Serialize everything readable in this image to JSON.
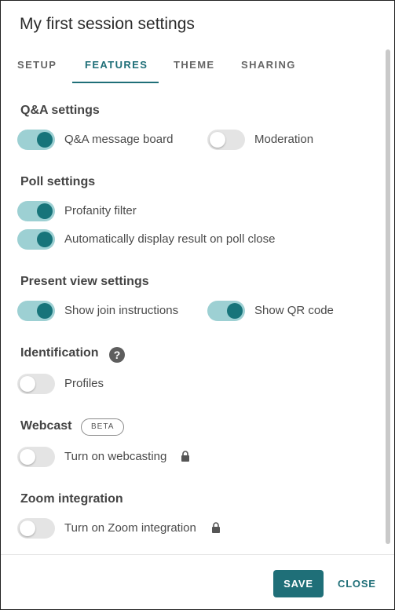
{
  "dialog": {
    "title": "My first session settings"
  },
  "tabs": [
    {
      "label": "SETUP",
      "active": false
    },
    {
      "label": "FEATURES",
      "active": true
    },
    {
      "label": "THEME",
      "active": false
    },
    {
      "label": "SHARING",
      "active": false
    }
  ],
  "sections": {
    "qa": {
      "title": "Q&A settings",
      "message_board": {
        "label": "Q&A message board",
        "on": true
      },
      "moderation": {
        "label": "Moderation",
        "on": false
      }
    },
    "poll": {
      "title": "Poll settings",
      "profanity": {
        "label": "Profanity filter",
        "on": true
      },
      "auto_display": {
        "label": "Automatically display result on poll close",
        "on": true
      }
    },
    "present": {
      "title": "Present view settings",
      "join_instructions": {
        "label": "Show join instructions",
        "on": true
      },
      "qr_code": {
        "label": "Show QR code",
        "on": true
      }
    },
    "identification": {
      "title": "Identification",
      "help_icon": "question-circle-icon",
      "profiles": {
        "label": "Profiles",
        "on": false
      }
    },
    "webcast": {
      "title": "Webcast",
      "badge": "BETA",
      "webcasting": {
        "label": "Turn on webcasting",
        "on": false,
        "locked": true
      }
    },
    "zoom": {
      "title": "Zoom integration",
      "integration": {
        "label": "Turn on Zoom integration",
        "on": false,
        "locked": true
      }
    }
  },
  "footer": {
    "save_label": "SAVE",
    "close_label": "CLOSE"
  },
  "colors": {
    "accent": "#1f6f78",
    "toggle_on_track": "#9dd0d3",
    "toggle_off_track": "#e4e4e4"
  }
}
